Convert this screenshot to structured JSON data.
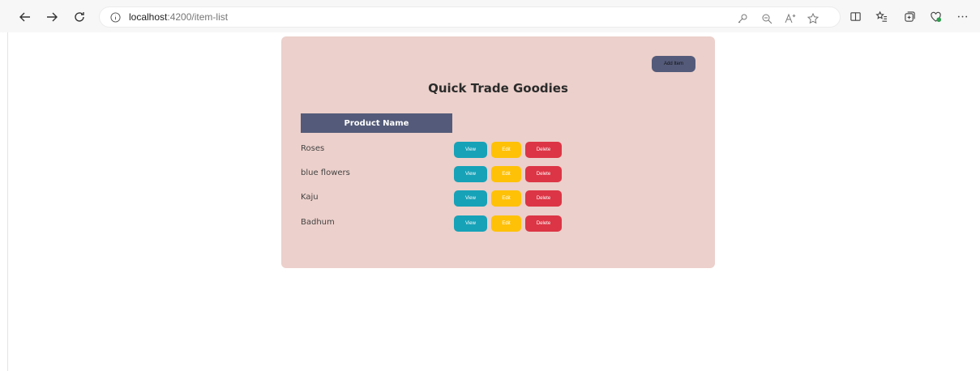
{
  "browser": {
    "url_host": "localhost",
    "url_path": ":4200/item-list"
  },
  "page": {
    "add_button_label": "Add Item",
    "title": "Quick Trade Goodies",
    "column_header": "Product Name",
    "items": [
      {
        "name": "Roses",
        "view": "View",
        "edit": "Edit",
        "delete": "Delete"
      },
      {
        "name": "blue flowers",
        "view": "View",
        "edit": "Edit",
        "delete": "Delete"
      },
      {
        "name": "Kaju",
        "view": "View",
        "edit": "Edit",
        "delete": "Delete"
      },
      {
        "name": "Badhum",
        "view": "View",
        "edit": "Edit",
        "delete": "Delete"
      }
    ]
  },
  "colors": {
    "card_bg": "#ecd0cb",
    "header_bg": "#545b7a",
    "view": "#17a2b8",
    "edit": "#ffc107",
    "delete": "#dc3545"
  }
}
